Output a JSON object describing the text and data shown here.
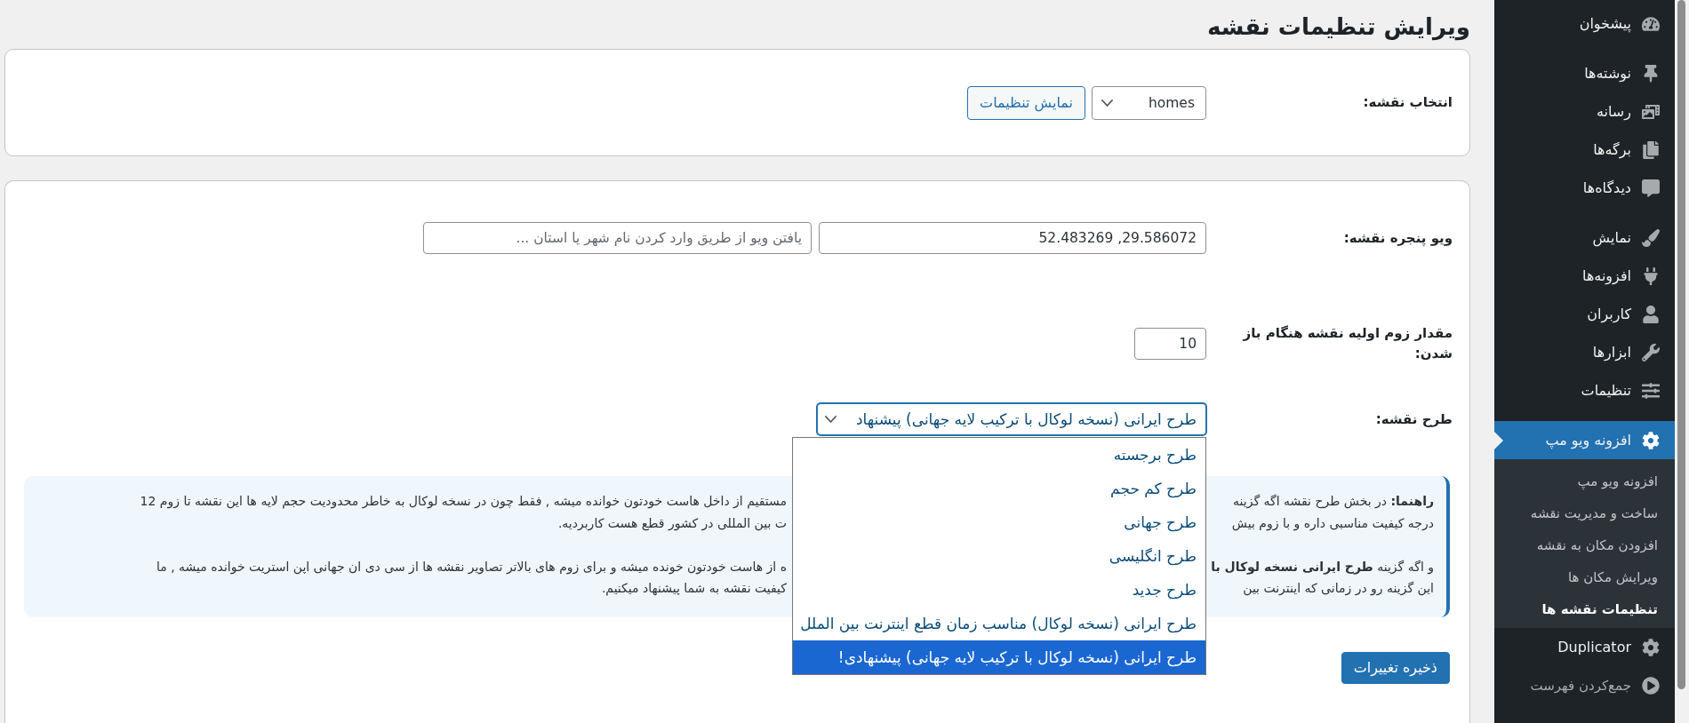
{
  "page_title": "ویرایش تنظیمات نقشه",
  "map_picker": {
    "label": "انتخاب نقشه:",
    "select": {
      "value": "homes"
    },
    "button": "نمایش تنظیمات"
  },
  "form": {
    "rows": [
      {
        "kind": "location",
        "label": "ویو پنجره نقشه:",
        "fields": [
          {
            "value": "29.586072, 52.483269"
          },
          {
            "placeholder": "یافتن ویو از طریق وارد کردن نام شهر یا استان ..."
          }
        ]
      },
      {
        "kind": "number",
        "label": "مقدار زوم اولیه نقشه هنگام باز شدن:",
        "fields": [
          {
            "value": "10"
          }
        ]
      },
      {
        "kind": "dropdown",
        "label": "طرح نقشه:",
        "value": "طرح ایرانی (نسخه لوکال با ترکیب لایه جهانی) پیشنهاد",
        "expanded": true,
        "options": [
          {
            "label": "طرح برجسته",
            "selected": false
          },
          {
            "label": "طرح کم حجم",
            "selected": false
          },
          {
            "label": "طرح جهانی",
            "selected": false
          },
          {
            "label": "طرح انگلیسی",
            "selected": false
          },
          {
            "label": "طرح جدید",
            "selected": false
          },
          {
            "label": "طرح ایرانی (نسخه لوکال) مناسب زمان قطع اینترنت بین الملل",
            "selected": false
          },
          {
            "label": "طرح ایرانی (نسخه لوکال با ترکیب لایه جهانی) پیشنهادی!",
            "selected": true
          }
        ]
      }
    ]
  },
  "notice": {
    "paragraphs": [
      {
        "lines": [
          {
            "start": "**راهنما:** در بخش طرح نقشه اگه گزینه",
            "end": "مستقیم از داخل هاست خودتون خوانده میشه , فقط چون در نسخه لوکال به خاطر محدودیت حجم لایه ها این نقشه تا زوم 12"
          },
          {
            "start": "درجه کیفیت مناسبی داره و با زوم بیش",
            "end": "ت بین المللی در کشور قطع هست کاربردیه."
          }
        ]
      },
      {
        "lines": [
          {
            "start": "و اگه گزینه **طرح ایرانی نسخه لوکال با**",
            "end": "ه از هاست خودتون خونده میشه و برای زوم های بالاتر تصاویر نقشه ها از سی دی ان جهانی اپن استریت خوانده میشه , ما"
          },
          {
            "start": "این گزینه رو در زمانی که اینترنت بین",
            "end": "کیفیت نقشه به شما پیشنهاد میکنیم."
          }
        ]
      }
    ]
  },
  "save_button": "ذخیره تغییرات",
  "sidebar": {
    "groups": [
      {
        "items": [
          {
            "label": "پیشخوان",
            "selected": false
          }
        ]
      },
      {
        "items": [
          {
            "label": "نوشته‌ها",
            "selected": false
          },
          {
            "label": "رسانه",
            "selected": false
          },
          {
            "label": "برگه‌ها",
            "selected": false
          },
          {
            "label": "دیدگاه‌ها",
            "selected": false
          }
        ]
      },
      {
        "items": [
          {
            "label": "نمایش",
            "selected": false
          },
          {
            "label": "افزونه‌ها",
            "selected": false
          },
          {
            "label": "کاربران",
            "selected": false
          },
          {
            "label": "ابزارها",
            "selected": false
          },
          {
            "label": "تنظیمات",
            "selected": false
          }
        ]
      },
      {
        "items": [
          {
            "label": "افزونه ویو مپ",
            "selected": true,
            "submenu": [
              {
                "label": "افزونه ویو مپ",
                "selected": false
              },
              {
                "label": "ساخت و مدیریت نقشه",
                "selected": false
              },
              {
                "label": "افزودن مکان به نقشه",
                "selected": false
              },
              {
                "label": "ویرایش مکان ها",
                "selected": false
              },
              {
                "label": "تنظیمات نقشه ها",
                "selected": true
              }
            ]
          },
          {
            "label": "Duplicator",
            "selected": false
          }
        ]
      }
    ],
    "collapse": "جمع‌کردن فهرست"
  }
}
